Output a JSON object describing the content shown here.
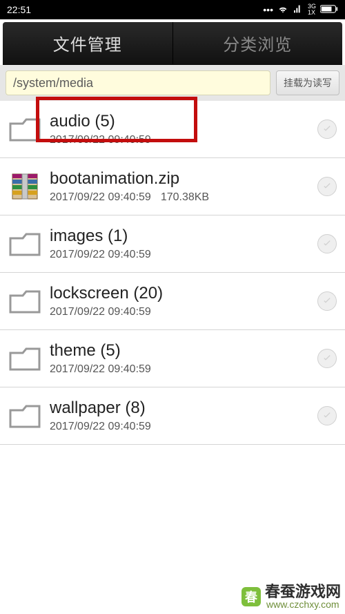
{
  "status": {
    "time": "22:51",
    "signal_label": "3G",
    "extra": "1X"
  },
  "tabs": {
    "file_mgmt": "文件管理",
    "category": "分类浏览"
  },
  "pathbar": {
    "path": "/system/media",
    "mount_btn": "挂载为读写"
  },
  "items": [
    {
      "icon": "folder",
      "name": "audio  (5)",
      "datetime": "2017/09/22 09:40:59",
      "size": "",
      "highlighted": true
    },
    {
      "icon": "archive",
      "name": "bootanimation.zip",
      "datetime": "2017/09/22 09:40:59",
      "size": "170.38KB",
      "highlighted": false
    },
    {
      "icon": "folder",
      "name": "images  (1)",
      "datetime": "2017/09/22 09:40:59",
      "size": "",
      "highlighted": false
    },
    {
      "icon": "folder",
      "name": "lockscreen  (20)",
      "datetime": "2017/09/22 09:40:59",
      "size": "",
      "highlighted": false
    },
    {
      "icon": "folder",
      "name": "theme  (5)",
      "datetime": "2017/09/22 09:40:59",
      "size": "",
      "highlighted": false
    },
    {
      "icon": "folder",
      "name": "wallpaper  (8)",
      "datetime": "2017/09/22 09:40:59",
      "size": "",
      "highlighted": false
    }
  ],
  "watermark": {
    "brand": "春蚕游戏网",
    "url": "www.czchxy.com"
  }
}
